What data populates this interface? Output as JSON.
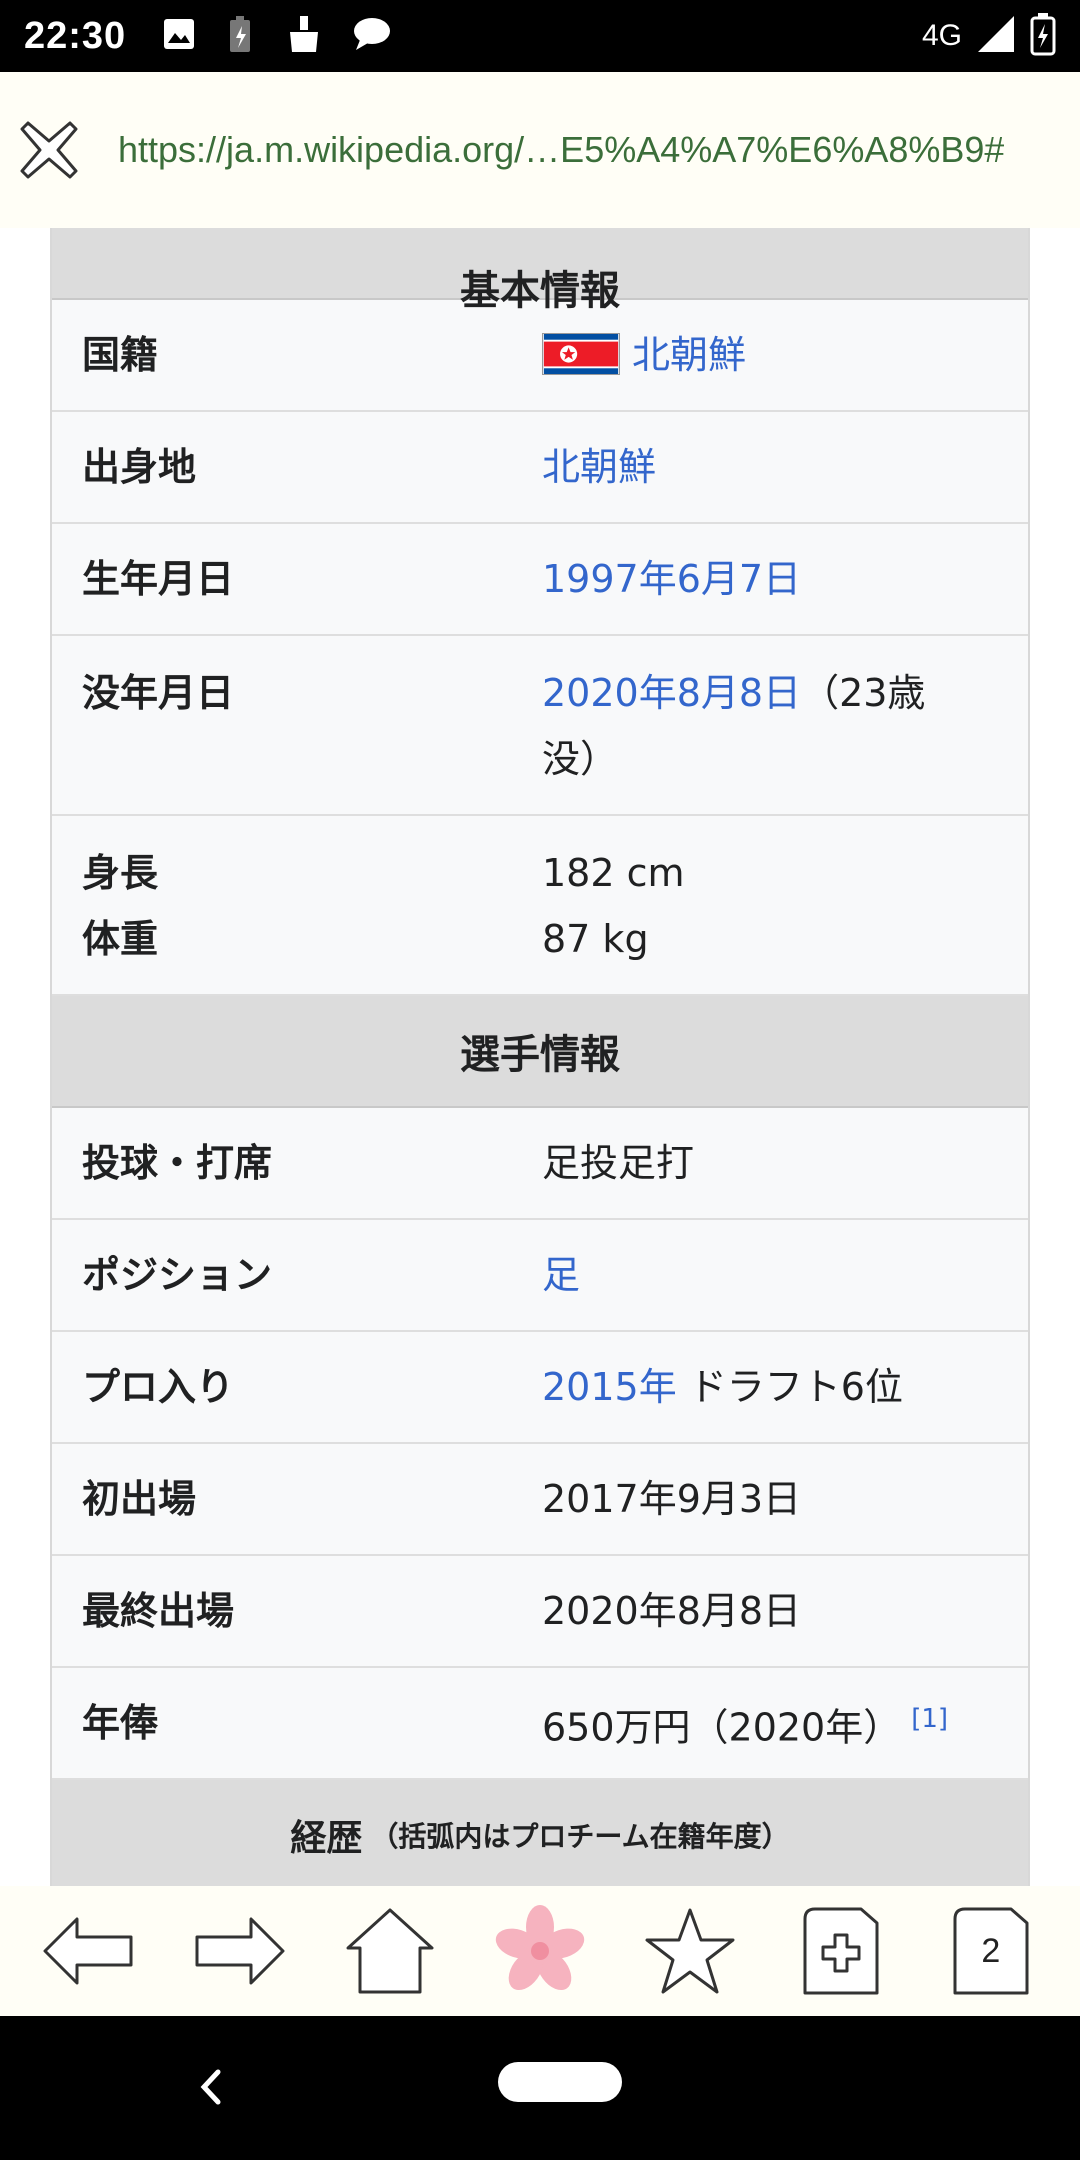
{
  "status_bar": {
    "time": "22:30",
    "network": "4G",
    "icons_left": [
      "image-icon",
      "no-battery-sync-icon",
      "cleaner-icon",
      "chat-icon"
    ],
    "icons_right": [
      "signal-icon",
      "battery-charging-icon"
    ]
  },
  "url_bar": {
    "url": "https://ja.m.wikipedia.org/…E5%A4%A7%E6%A8%B9#"
  },
  "infobox": {
    "cut_header": "基本情報",
    "rows_basic": [
      {
        "label": "国籍",
        "value_link": "北朝鮮",
        "has_flag": true
      },
      {
        "label": "出身地",
        "value_link": "北朝鮮"
      },
      {
        "label": "生年月日",
        "value_link": "1997年6月7日"
      },
      {
        "label": "没年月日",
        "value_link": "2020年8月8日",
        "value_rest": "（23歳",
        "value_line2": "没）"
      },
      {
        "label": "身長",
        "label2": "体重",
        "value": "182 cm",
        "value_line2": "87 kg"
      }
    ],
    "section_player": "選手情報",
    "rows_player": [
      {
        "label": "投球・打席",
        "value": "足投足打"
      },
      {
        "label": "ポジション",
        "value_link": "足"
      },
      {
        "label": "プロ入り",
        "value_link": "2015年",
        "value_rest": " ドラフト6位"
      },
      {
        "label": "初出場",
        "value": "2017年9月3日"
      },
      {
        "label": "最終出場",
        "value": "2020年8月8日"
      },
      {
        "label": "年俸",
        "value": "650万円（2020年）",
        "ref": "[1]"
      }
    ],
    "section_career": "経歴",
    "section_career_sub": "（括弧内はプロチーム在籍年度）"
  },
  "toolbar": {
    "tab_count": "2",
    "accent_sakura": "#f4a7b5"
  }
}
